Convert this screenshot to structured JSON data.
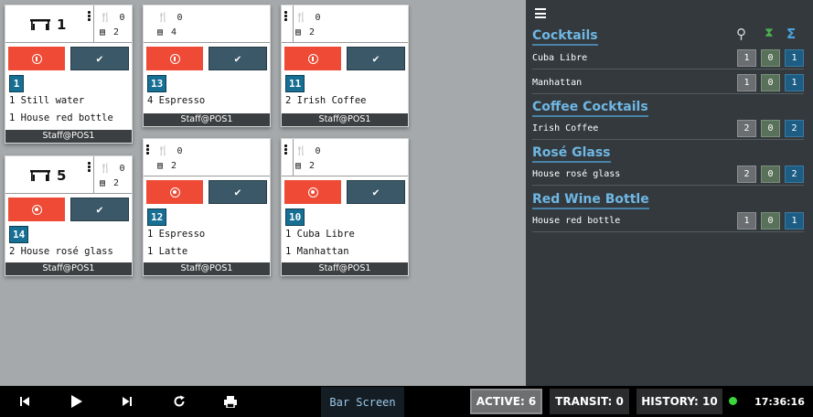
{
  "orders": [
    {
      "table": "1",
      "counts": {
        "guests": "0",
        "orders": "2"
      },
      "badge": "1",
      "items": [
        "1 Still water",
        "1 House red bottle"
      ],
      "footer": "Staff@POS1",
      "cancel_icon": "pause-ring-icon"
    },
    {
      "table": "",
      "counts": {
        "guests": "0",
        "orders": "4"
      },
      "badge": "13",
      "items": [
        "4 Espresso"
      ],
      "footer": "Staff@POS1",
      "cancel_icon": "pause-ring-icon"
    },
    {
      "table": "",
      "counts": {
        "guests": "0",
        "orders": "2"
      },
      "badge": "11",
      "items": [
        "2 Irish Coffee"
      ],
      "footer": "Staff@POS1",
      "cancel_icon": "pause-ring-icon"
    },
    {
      "table": "5",
      "counts": {
        "guests": "0",
        "orders": "2"
      },
      "badge": "14",
      "items": [
        "2 House rosé glass"
      ],
      "footer": "Staff@POS1",
      "cancel_icon": "record-ring-icon"
    },
    {
      "table": "",
      "counts": {
        "guests": "0",
        "orders": "2"
      },
      "badge": "12",
      "items": [
        "1 Espresso",
        "1 Latte"
      ],
      "footer": "Staff@POS1",
      "cancel_icon": "record-ring-icon"
    },
    {
      "table": "",
      "counts": {
        "guests": "0",
        "orders": "2"
      },
      "badge": "10",
      "items": [
        "1 Cuba Libre",
        "1 Manhattan"
      ],
      "footer": "Staff@POS1",
      "cancel_icon": "record-ring-icon"
    }
  ],
  "summary": {
    "columns_icons": [
      "waiter-icon",
      "hourglass-icon",
      "sigma-icon"
    ],
    "categories": [
      {
        "name": "Cocktails",
        "items": [
          {
            "name": "Cuba Libre",
            "a": "1",
            "b": "0",
            "c": "1"
          },
          {
            "name": "Manhattan",
            "a": "1",
            "b": "0",
            "c": "1"
          }
        ]
      },
      {
        "name": "Coffee Cocktails",
        "items": [
          {
            "name": "Irish Coffee",
            "a": "2",
            "b": "0",
            "c": "2"
          }
        ]
      },
      {
        "name": "Rosé Glass",
        "items": [
          {
            "name": "House rosé glass",
            "a": "2",
            "b": "0",
            "c": "2"
          }
        ]
      },
      {
        "name": "Red Wine Bottle",
        "items": [
          {
            "name": "House red bottle",
            "a": "1",
            "b": "0",
            "c": "1"
          }
        ]
      }
    ]
  },
  "bottombar": {
    "screen_label": "Bar Screen",
    "active": "ACTIVE: 6",
    "transit": "TRANSIT: 0",
    "history": "HISTORY: 10",
    "clock": "17:36:16",
    "status_color": "#3bd63b"
  },
  "colors": {
    "accent_red": "#ee4a35",
    "accent_dark": "#3a5867",
    "badge_blue": "#176f93",
    "category_blue": "#6fb7e4"
  }
}
